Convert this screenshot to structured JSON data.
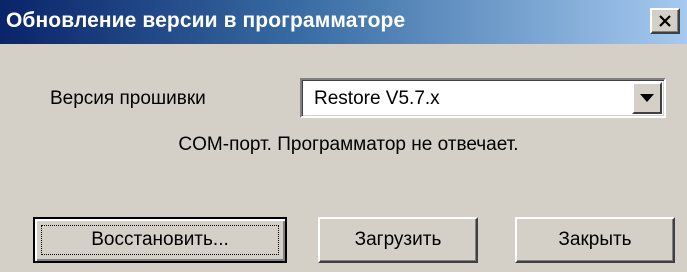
{
  "window": {
    "title": "Обновление версии в программаторе",
    "close_glyph": "×"
  },
  "form": {
    "version_label": "Версия прошивки",
    "version_select": {
      "selected_value": "Restore V5.7.x"
    },
    "status_text": "COM-порт. Программатор не отвечает."
  },
  "buttons": {
    "restore_label": "Восстановить...",
    "load_label": "Загрузить",
    "close_label": "Закрыть"
  },
  "colors": {
    "title_gradient_start": "#0a246a",
    "title_gradient_end": "#a6caf0",
    "dialog_face": "#d4d0c8"
  },
  "icons": {
    "close": "close-icon",
    "dropdown": "chevron-down-icon"
  }
}
